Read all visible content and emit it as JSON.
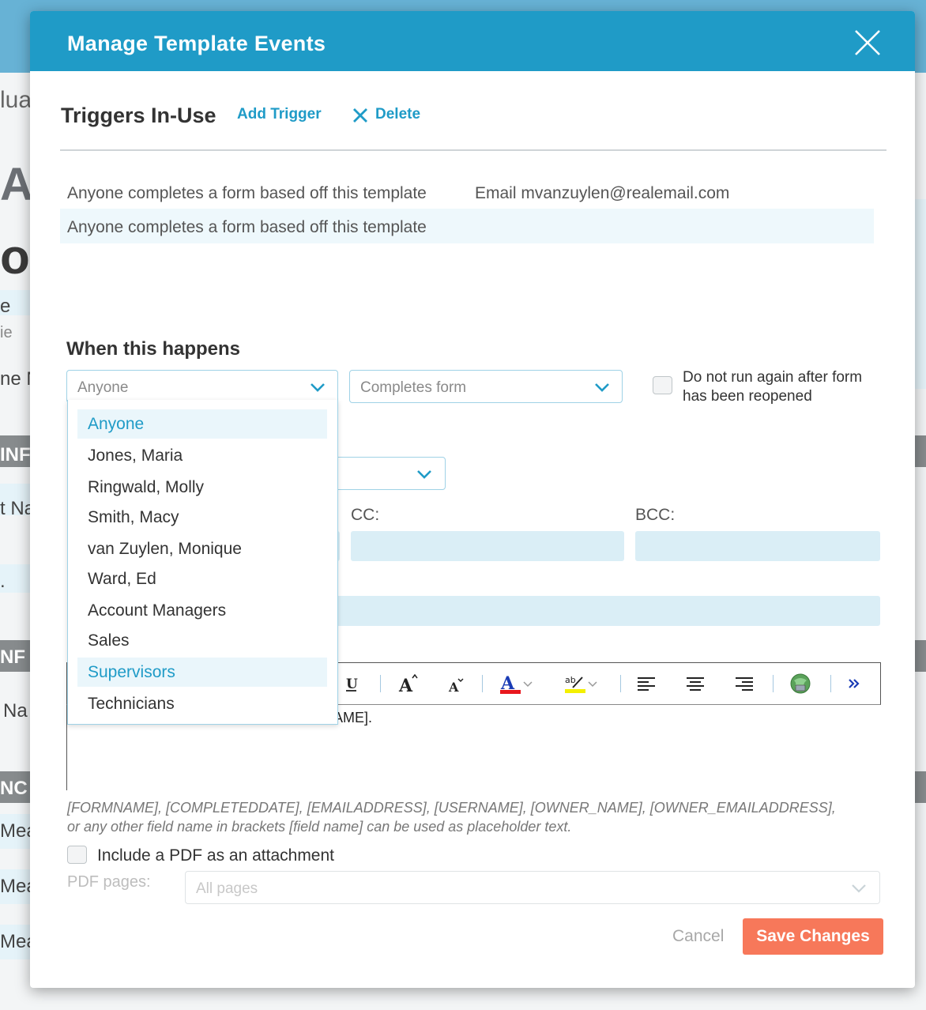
{
  "background": {
    "fragments": [
      "lua",
      "A",
      "oy",
      "e",
      "ie",
      "ne N",
      "INF",
      "t Na",
      ".",
      "NF",
      "Na",
      "NC",
      "Mea",
      "Mea",
      "Mea"
    ]
  },
  "modal": {
    "title": "Manage Template Events",
    "close_icon": "close-icon"
  },
  "triggers": {
    "section_title": "Triggers In-Use",
    "add_label": "Add Trigger",
    "delete_label": "Delete",
    "rows": [
      {
        "event": "Anyone completes a form based off this template",
        "action": "Email mvanzuylen@realemail.com",
        "selected": false
      },
      {
        "event": "Anyone completes a form based off this template",
        "action": "",
        "selected": true
      }
    ]
  },
  "when": {
    "title": "When this happens",
    "who_value": "Anyone",
    "event_value": "Completes form",
    "reopen_label_1": "Do not run again after form",
    "reopen_label_2": "has been reopened"
  },
  "dropdown": {
    "options": [
      "Anyone",
      "Jones, Maria",
      "Ringwald, Molly",
      "Smith, Macy",
      "van Zuylen, Monique",
      "Ward, Ed",
      "Account Managers",
      "Sales",
      "Supervisors",
      "Technicians"
    ],
    "selected": "Anyone",
    "hovered": "Supervisors"
  },
  "email": {
    "cc_label": "CC:",
    "bcc_label": "BCC:",
    "body_visible_text": "AME]."
  },
  "toolbar": {
    "buttons": [
      "underline-icon",
      "font-size-increase-icon",
      "font-size-decrease-icon",
      "text-color-icon",
      "highlight-color-icon",
      "align-left-icon",
      "align-center-icon",
      "align-right-icon",
      "insert-link-icon",
      "more-icon"
    ],
    "text_color": "#e8171d",
    "highlight_color": "#f4f000"
  },
  "hint": {
    "line1": "[FORMNAME], [COMPLETEDDATE], [EMAILADDRESS], [USERNAME], [OWNER_NAME], [OWNER_EMAILADDRESS],",
    "line2": "or any other field name in brackets [field name] can be used as placeholder text."
  },
  "pdf": {
    "include_label": "Include a PDF as an attachment",
    "pages_label": "PDF pages:",
    "pages_placeholder": "All pages"
  },
  "footer": {
    "cancel_label": "Cancel",
    "save_label": "Save Changes"
  },
  "colors": {
    "header": "#1f9bc7",
    "accent": "#1f9bc7",
    "save": "#f7785a",
    "input_fill": "#daeef6"
  }
}
